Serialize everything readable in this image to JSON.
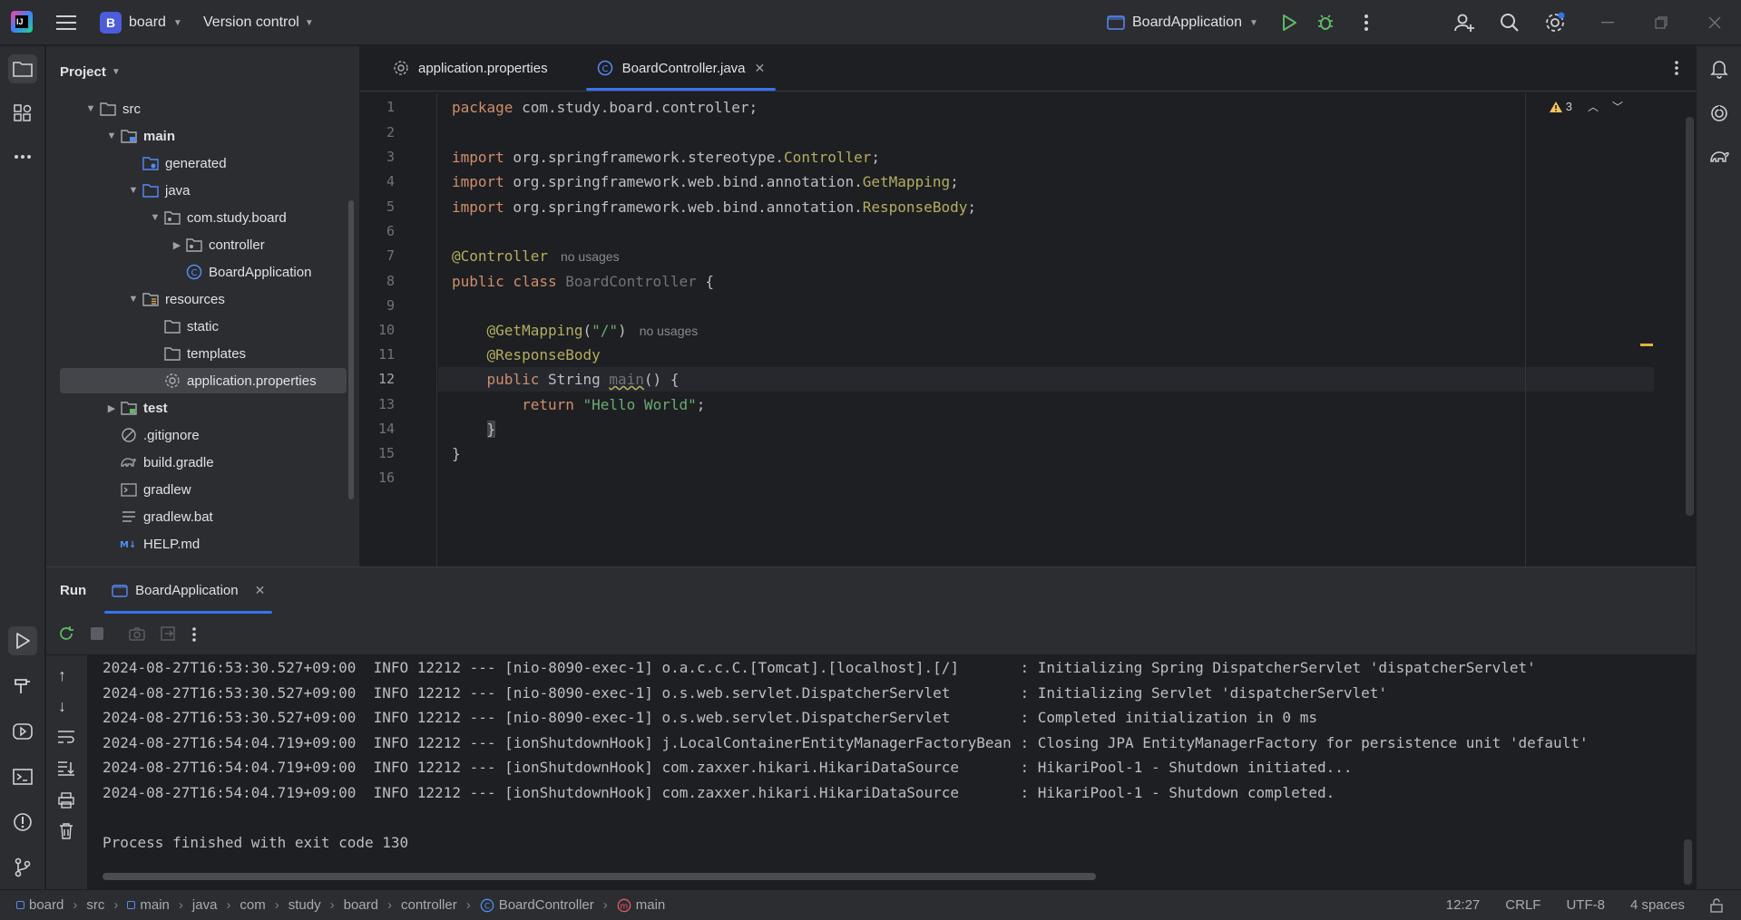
{
  "titlebar": {
    "project_badge": "B",
    "project_name": "board",
    "vcs_label": "Version control",
    "run_config": "BoardApplication"
  },
  "project_panel": {
    "title": "Project",
    "items": [
      {
        "label": "src",
        "bold": false
      },
      {
        "label": "main",
        "bold": true
      },
      {
        "label": "generated",
        "bold": false
      },
      {
        "label": "java",
        "bold": false
      },
      {
        "label": "com.study.board",
        "bold": false
      },
      {
        "label": "controller",
        "bold": false
      },
      {
        "label": "BoardApplication",
        "bold": false
      },
      {
        "label": "resources",
        "bold": false
      },
      {
        "label": "static",
        "bold": false
      },
      {
        "label": "templates",
        "bold": false
      },
      {
        "label": "application.properties",
        "bold": false
      },
      {
        "label": "test",
        "bold": true
      },
      {
        "label": ".gitignore",
        "bold": false
      },
      {
        "label": "build.gradle",
        "bold": false
      },
      {
        "label": "gradlew",
        "bold": false
      },
      {
        "label": "gradlew.bat",
        "bold": false
      },
      {
        "label": "HELP.md",
        "bold": false
      }
    ]
  },
  "editor": {
    "tabs": [
      {
        "label": "application.properties"
      },
      {
        "label": "BoardController.java"
      }
    ],
    "warnings_count": "3",
    "line_numbers": [
      "1",
      "2",
      "3",
      "4",
      "5",
      "6",
      "7",
      "8",
      "9",
      "10",
      "11",
      "12",
      "13",
      "14",
      "15",
      "16"
    ],
    "code": {
      "l1": {
        "kw": "package",
        "rest": " com.study.board.controller;"
      },
      "l3": {
        "kw": "import",
        "pre": " org.springframework.stereotype.",
        "cls": "Controller",
        "end": ";"
      },
      "l4": {
        "kw": "import",
        "pre": " org.springframework.web.bind.annotation.",
        "cls": "GetMapping",
        "end": ";"
      },
      "l5": {
        "kw": "import",
        "pre": " org.springframework.web.bind.annotation.",
        "cls": "ResponseBody",
        "end": ";"
      },
      "l7": {
        "an": "@Controller",
        "hint": "no usages"
      },
      "l8": {
        "kw": "public class",
        "name": " BoardController",
        "end": " {"
      },
      "l10": {
        "indent": "    ",
        "an": "@GetMapping",
        "open": "(",
        "str": "\"/\"",
        "close": ")",
        "hint": "no usages"
      },
      "l11": {
        "indent": "    ",
        "an": "@ResponseBody"
      },
      "l12": {
        "indent": "    ",
        "kw": "public",
        "type": " String ",
        "fn": "main",
        "end": "() {"
      },
      "l13": {
        "indent": "        ",
        "kw": "return",
        "sp": " ",
        "str": "\"Hello World\"",
        "end": ";"
      },
      "l14": {
        "indent": "    ",
        "brace": "}"
      },
      "l15": {
        "brace": "}"
      }
    }
  },
  "run_panel": {
    "title": "Run",
    "tab": "BoardApplication",
    "console": [
      "2024-08-27T16:53:30.527+09:00  INFO 12212 --- [nio-8090-exec-1] o.a.c.c.C.[Tomcat].[localhost].[/]       : Initializing Spring DispatcherServlet 'dispatcherServlet'",
      "2024-08-27T16:53:30.527+09:00  INFO 12212 --- [nio-8090-exec-1] o.s.web.servlet.DispatcherServlet        : Initializing Servlet 'dispatcherServlet'",
      "2024-08-27T16:53:30.527+09:00  INFO 12212 --- [nio-8090-exec-1] o.s.web.servlet.DispatcherServlet        : Completed initialization in 0 ms",
      "2024-08-27T16:54:04.719+09:00  INFO 12212 --- [ionShutdownHook] j.LocalContainerEntityManagerFactoryBean : Closing JPA EntityManagerFactory for persistence unit 'default'",
      "2024-08-27T16:54:04.719+09:00  INFO 12212 --- [ionShutdownHook] com.zaxxer.hikari.HikariDataSource       : HikariPool-1 - Shutdown initiated...",
      "2024-08-27T16:54:04.719+09:00  INFO 12212 --- [ionShutdownHook] com.zaxxer.hikari.HikariDataSource       : HikariPool-1 - Shutdown completed.",
      "",
      "Process finished with exit code 130"
    ]
  },
  "status_bar": {
    "breadcrumbs": [
      "board",
      "src",
      "main",
      "java",
      "com",
      "study",
      "board",
      "controller",
      "BoardController",
      "main"
    ],
    "position": "12:27",
    "line_ending": "CRLF",
    "encoding": "UTF-8",
    "indent": "4 spaces"
  }
}
